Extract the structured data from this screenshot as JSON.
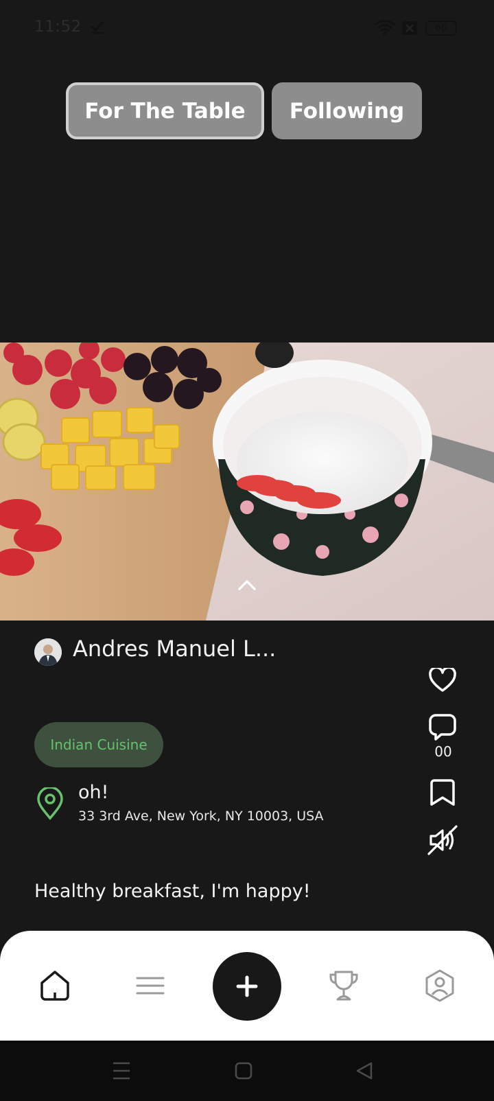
{
  "status_bar": {
    "time": "11:52",
    "battery": "60",
    "icons": [
      "check-icon",
      "wifi-icon",
      "sim-off-icon",
      "battery-icon"
    ]
  },
  "feed_tabs": [
    {
      "label": "For The Table",
      "active": true
    },
    {
      "label": "Following",
      "active": false
    }
  ],
  "post": {
    "author": "Andres Manuel L...",
    "cuisine": "Indian Cuisine",
    "place_name": "oh!",
    "address": "33 3rd Ave, New York, NY 10003, USA",
    "caption": "Healthy breakfast, I'm happy!",
    "comment_count": "00",
    "image": "food-photo"
  },
  "actions": [
    "heart-icon",
    "comment-icon",
    "bookmark-icon",
    "mute-icon"
  ],
  "bottom_nav": [
    "home-icon",
    "menu-lines-icon",
    "plus-icon",
    "trophy-icon",
    "profile-icon"
  ],
  "colors": {
    "background": "#181818",
    "tab": "#8d8d8d",
    "chip_bg": "#3e513e",
    "chip_text": "#66c26c",
    "pin": "#66c26c",
    "nav_bg": "#ffffff"
  }
}
